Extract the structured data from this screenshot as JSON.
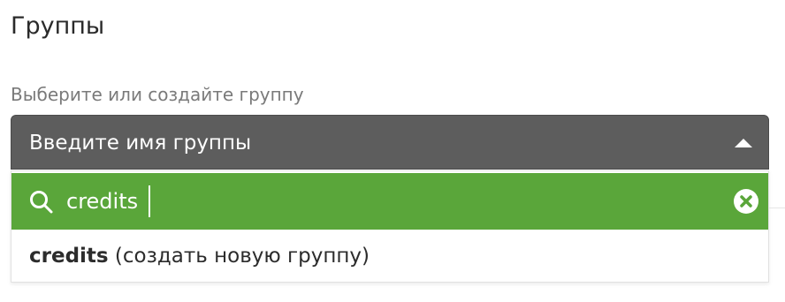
{
  "section": {
    "title": "Группы"
  },
  "field": {
    "label": "Выберите или создайте группу",
    "selected_value": "Введите имя группы",
    "toggle_icon": "chevron-up-icon"
  },
  "dropdown": {
    "search": {
      "value": "credits",
      "icon": "search-icon",
      "clear_icon": "clear-icon"
    },
    "options": [
      {
        "bold_text": "credits",
        "suffix_text": " (создать новую группу)"
      }
    ]
  },
  "colors": {
    "select_bg": "#5d5d5d",
    "search_bg": "#5aa63a",
    "text_dark": "#2c2c2c",
    "label_gray": "#7a7a7a",
    "white": "#ffffff"
  }
}
